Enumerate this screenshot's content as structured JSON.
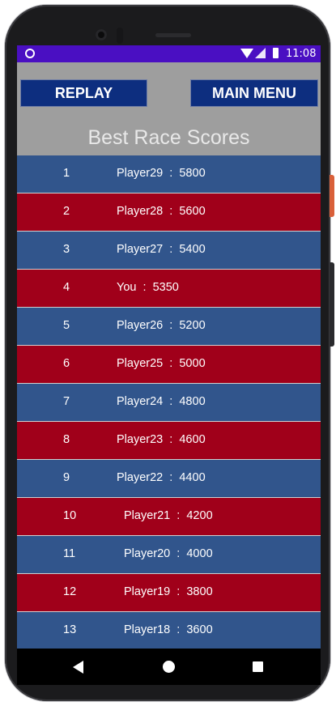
{
  "status": {
    "time": "11:08"
  },
  "buttons": {
    "replay": "REPLAY",
    "main_menu": "MAIN MENU"
  },
  "title": "Best Race Scores",
  "scores": [
    {
      "rank": "1",
      "entry": "Player29  :  5800"
    },
    {
      "rank": "2",
      "entry": "Player28  :  5600"
    },
    {
      "rank": "3",
      "entry": "Player27  :  5400"
    },
    {
      "rank": "4",
      "entry": "You  :  5350"
    },
    {
      "rank": "5",
      "entry": "Player26  :  5200"
    },
    {
      "rank": "6",
      "entry": "Player25  :  5000"
    },
    {
      "rank": "7",
      "entry": "Player24  :  4800"
    },
    {
      "rank": "8",
      "entry": "Player23  :  4600"
    },
    {
      "rank": "9",
      "entry": "Player22  :  4400"
    },
    {
      "rank": "10",
      "entry": "Player21  :  4200"
    },
    {
      "rank": "11",
      "entry": "Player20  :  4000"
    },
    {
      "rank": "12",
      "entry": "Player19  :  3800"
    },
    {
      "rank": "13",
      "entry": "Player18  :  3600"
    }
  ],
  "colors": {
    "status_bar": "#4a0fc2",
    "button": "#0d2e7f",
    "row_blue": "#31558c",
    "row_red": "#a0001a",
    "background": "#9e9e9e"
  },
  "icons": {
    "status_left": "circle-icon",
    "wifi": "wifi-icon",
    "signal": "signal-icon",
    "battery": "battery-icon",
    "back": "back-triangle-icon",
    "home": "home-circle-icon",
    "recent": "recent-square-icon"
  }
}
